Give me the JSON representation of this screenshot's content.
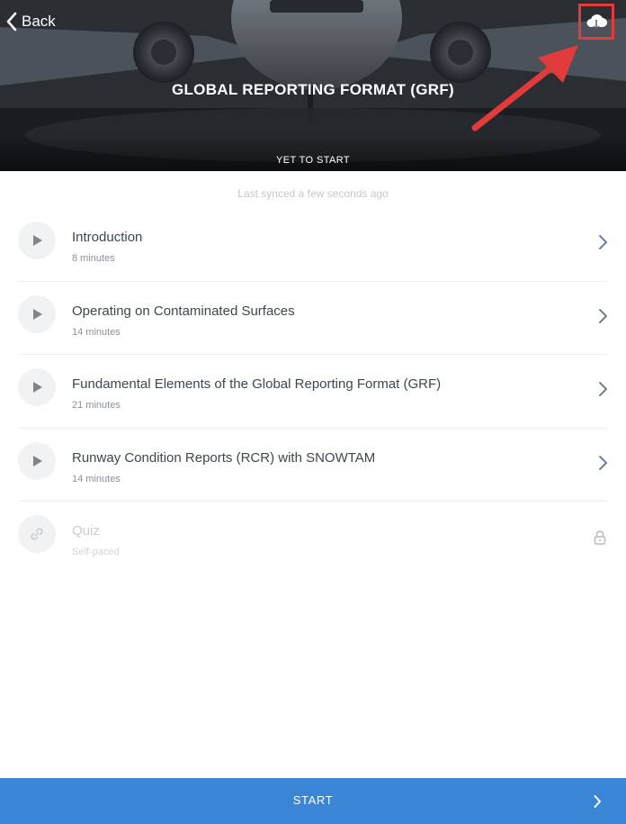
{
  "header": {
    "back_label": "Back",
    "title": "GLOBAL REPORTING FORMAT (GRF)",
    "status": "YET TO START",
    "download_icon": "cloud-download-icon"
  },
  "sync": {
    "text": "Last synced a few seconds ago"
  },
  "lessons": [
    {
      "title": "Introduction",
      "duration": "8 minutes",
      "icon": "play-icon"
    },
    {
      "title": "Operating on Contaminated Surfaces",
      "duration": "14 minutes",
      "icon": "play-icon"
    },
    {
      "title": "Fundamental Elements of the Global Reporting Format (GRF)",
      "duration": "21 minutes",
      "icon": "play-icon"
    },
    {
      "title": "Runway Condition Reports (RCR) with SNOWTAM",
      "duration": "14 minutes",
      "icon": "play-icon"
    },
    {
      "title": "Quiz",
      "duration": "Self-paced",
      "icon": "link-icon",
      "locked": true
    }
  ],
  "footer": {
    "start_label": "START"
  },
  "colors": {
    "accent": "#3a86d4",
    "annotation": "#e23b3b",
    "text_primary": "#3d4750",
    "text_muted": "#8a9199"
  }
}
